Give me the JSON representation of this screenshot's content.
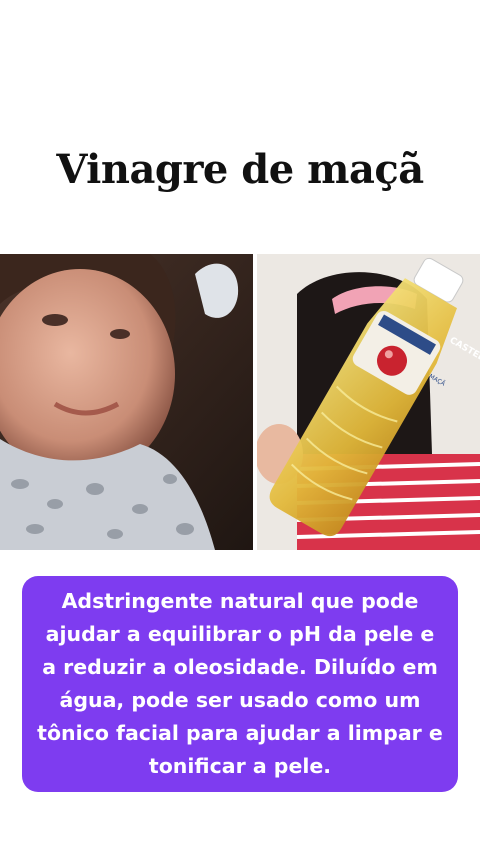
{
  "title": "Vinagre de maçã",
  "images": {
    "left": {
      "label": "woman-applying-toner-photo"
    },
    "right": {
      "label": "apple-vinegar-bottle-photo",
      "bottle_brand": "CASTELO",
      "bottle_variant": "MAÇÃ"
    }
  },
  "caption": "Adstringente natural que pode ajudar a equilibrar o pH da pele e a reduzir a oleosidade. Diluído em água, pode ser usado como um tônico facial para ajudar a limpar e tonificar a pele.",
  "colors": {
    "caption_bg": "#7e3cf0",
    "caption_text": "#ffffff",
    "title": "#111111"
  }
}
